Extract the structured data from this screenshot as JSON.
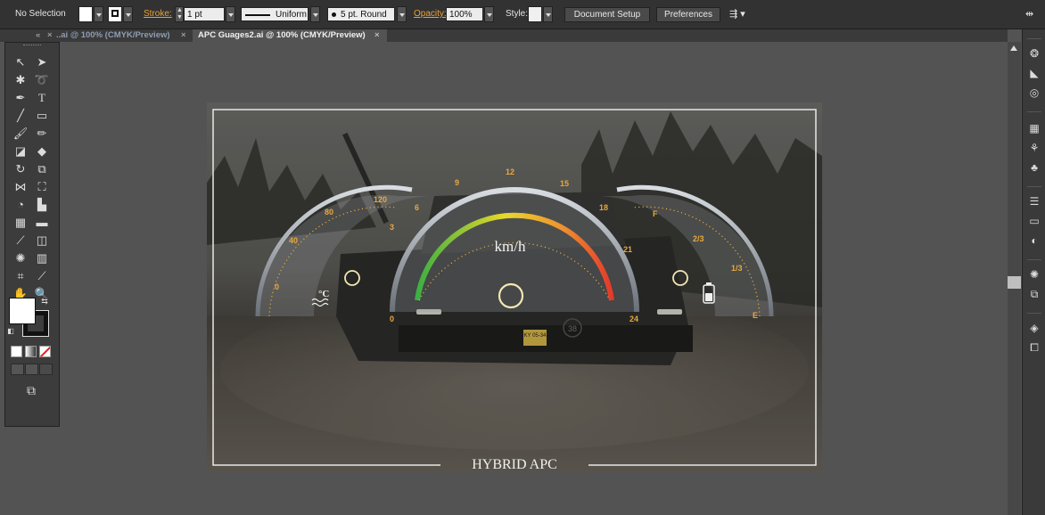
{
  "control_bar": {
    "selection": "No Selection",
    "stroke_label": "Stroke:",
    "stroke_weight": "1 pt",
    "profile": "Uniform",
    "brush": "5 pt. Round",
    "opacity_label": "Opacity:",
    "opacity_value": "100%",
    "style_label": "Style:",
    "document_setup": "Document Setup",
    "preferences": "Preferences"
  },
  "tabs": [
    {
      "label": "..ai @ 100% (CMYK/Preview)",
      "close": "×"
    },
    {
      "label": "APC Guages2.ai @ 100% (CMYK/Preview)",
      "close": "×"
    }
  ],
  "artwork": {
    "title": "HYBRID APC",
    "speed_unit": "km/h",
    "speed_ticks": [
      "0",
      "3",
      "6",
      "9",
      "12",
      "15",
      "18",
      "21",
      "24"
    ],
    "temp_ticks": [
      "0",
      "40",
      "80",
      "120"
    ],
    "temp_unit": "°C",
    "fuel_ticks": [
      "F",
      "2/3",
      "1/3",
      "E"
    ],
    "plate": "KY 05-34",
    "vehicle_number": "38"
  },
  "colors": {
    "accent_orange": "#e8a238",
    "gauge_tick": "#e6a840",
    "speed_green": "#3cb043",
    "speed_yellow": "#e8d82a",
    "speed_red": "#e33a2a"
  }
}
